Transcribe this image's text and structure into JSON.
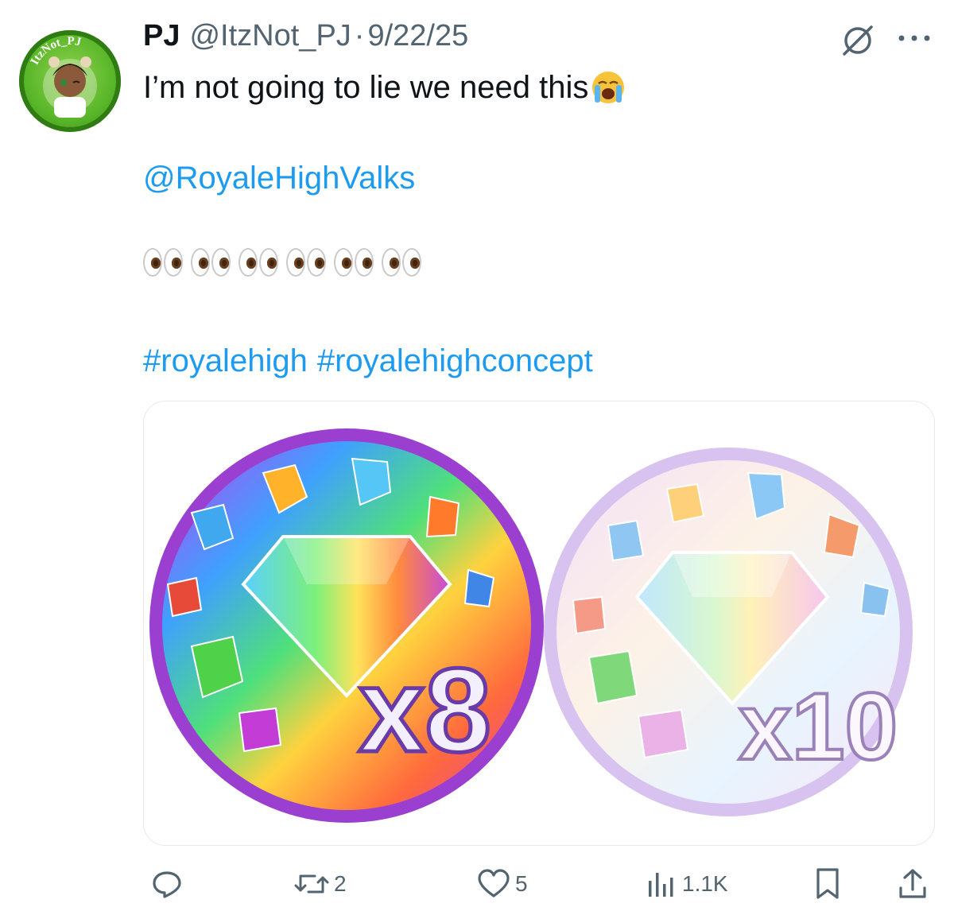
{
  "tweet": {
    "author_name": "PJ",
    "handle": "@ItzNot_PJ",
    "separator": "·",
    "date": "9/22/25",
    "avatar_label": "ItzNot_PJ",
    "text_line": "I’m not going to lie we need this",
    "text_emoji": "loudly-crying-face",
    "mention": "@RoyaleHighValks",
    "eyes_count": 6,
    "hashtags": [
      "#royalehigh",
      "#royalehighconcept"
    ]
  },
  "media": {
    "left_badge_label": "x8",
    "right_badge_label": "x10",
    "description_colors": {
      "left_rim": "#a64bd6",
      "right_rim": "#c9a7e6"
    }
  },
  "actions": {
    "reply_count": "",
    "retweet_count": "2",
    "like_count": "5",
    "views_count": "1.1K"
  },
  "colors": {
    "link": "#1d9bf0",
    "muted": "#536471",
    "text": "#0f1419"
  }
}
